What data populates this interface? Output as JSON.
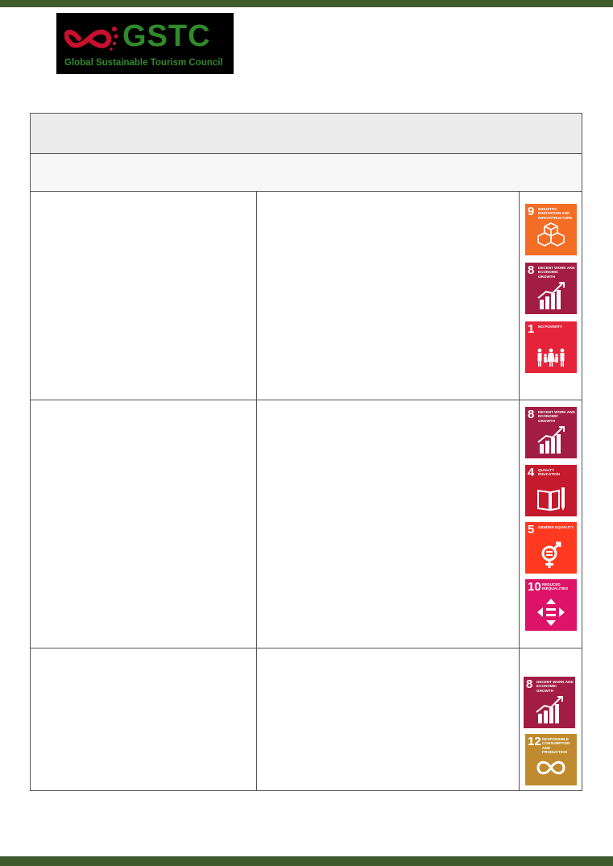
{
  "logo": {
    "name": "GSTC",
    "subtitle": "Global Sustainable Tourism Council",
    "colors": {
      "ring": "#c8102e",
      "text": "#2f8a2a",
      "background": "#000000"
    }
  },
  "colors": {
    "band": "#3d5b2b",
    "border": "#555555"
  },
  "rows": [
    {
      "goals": [
        {
          "number": "9",
          "title": "Industry, innovation and infrastructure",
          "color": "#f36d25",
          "icon": "cubes-icon"
        },
        {
          "number": "8",
          "title": "Decent work and economic growth",
          "color": "#a21c44",
          "icon": "growth-chart-icon"
        },
        {
          "number": "1",
          "title": "No poverty",
          "color": "#e5243b",
          "icon": "family-icon"
        }
      ]
    },
    {
      "goals": [
        {
          "number": "8",
          "title": "Decent work and economic growth",
          "color": "#a21c44",
          "icon": "growth-chart-icon"
        },
        {
          "number": "4",
          "title": "Quality education",
          "color": "#c5192d",
          "icon": "book-pencil-icon"
        },
        {
          "number": "5",
          "title": "Gender equality",
          "color": "#ff3a21",
          "icon": "gender-equality-icon"
        },
        {
          "number": "10",
          "title": "Reduced inequalities",
          "color": "#dd1367",
          "icon": "equal-arrows-icon"
        }
      ]
    },
    {
      "goals": [
        {
          "number": "8",
          "title": "Decent work and economic growth",
          "color": "#a21c44",
          "icon": "growth-chart-icon"
        },
        {
          "number": "12",
          "title": "Responsible consumption and production",
          "color": "#bf8b2e",
          "icon": "infinity-loop-icon"
        }
      ]
    }
  ]
}
